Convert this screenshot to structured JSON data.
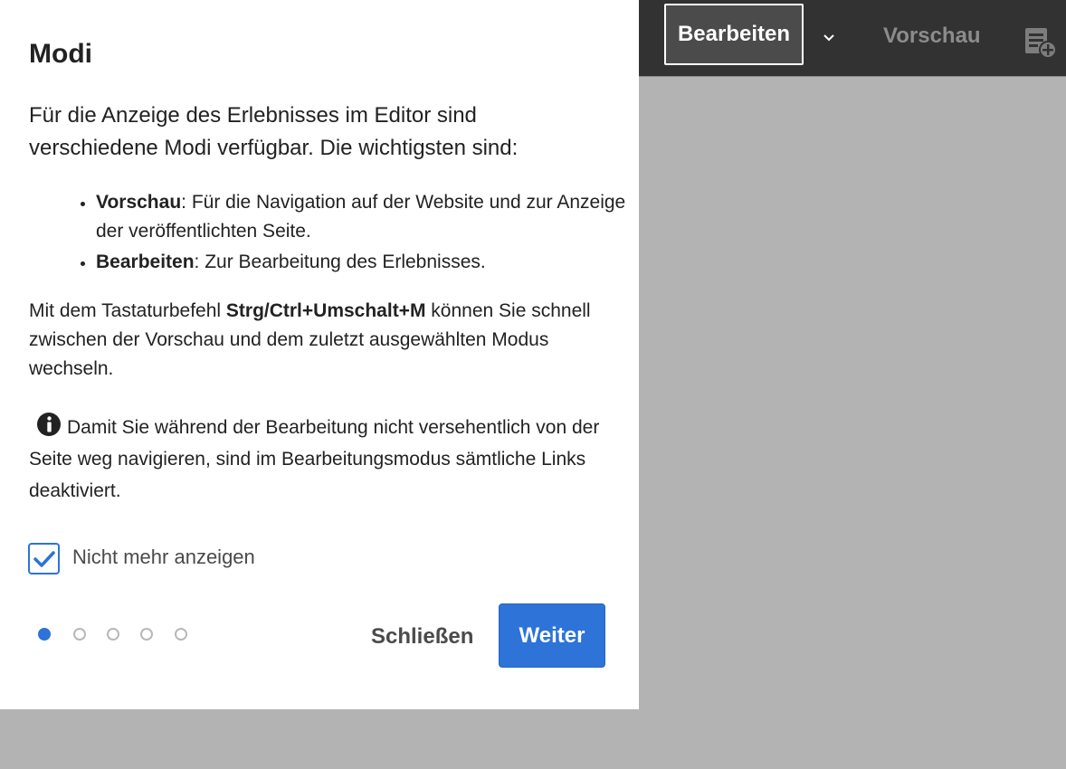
{
  "topbar": {
    "mode_selected": "Bearbeiten",
    "preview_label": "Vorschau",
    "icons": {
      "dropdown": "chevron-down-icon",
      "annotations": "annotation-add-icon"
    }
  },
  "dialog": {
    "title": "Modi",
    "intro": "Für die Anzeige des Erlebnisses im Editor sind verschiedene Modi verfügbar. Die wichtigsten sind:",
    "modes": [
      {
        "name": "Vorschau",
        "description": ": Für die Navigation auf der Website und zur Anzeige der veröffentlichten Seite."
      },
      {
        "name": "Bearbeiten",
        "description": ": Zur Bearbeitung des Erlebnisses."
      }
    ],
    "shortcut_before": "Mit dem Tastaturbefehl ",
    "shortcut_keys": "Strg/Ctrl+Umschalt+M",
    "shortcut_after": " können Sie schnell zwischen der Vorschau und dem zuletzt ausgewählten Modus wechseln.",
    "note": "Damit Sie während der Bearbeitung nicht versehentlich von der Seite weg navigieren, sind im Bearbeitungsmodus sämtliche Links deaktiviert.",
    "checkbox_label": "Nicht mehr anzeigen",
    "checkbox_checked": true,
    "pager": {
      "current": 1,
      "total": 5
    },
    "close_label": "Schließen",
    "next_label": "Weiter"
  },
  "colors": {
    "accent": "#2d73d8",
    "topbar_bg": "#323232",
    "canvas_bg": "#b3b3b3"
  }
}
